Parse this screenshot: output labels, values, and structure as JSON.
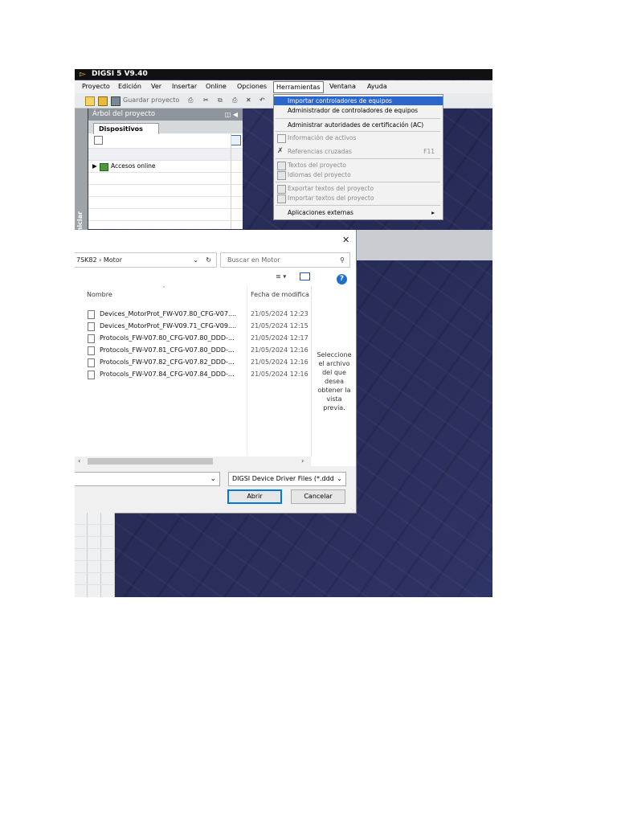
{
  "app": {
    "title": "DIGSI 5 V9.40"
  },
  "menubar": {
    "items": [
      "Proyecto",
      "Edición",
      "Ver",
      "Insertar",
      "Online",
      "Opciones",
      "Herramientas",
      "Ventana",
      "Ayuda"
    ]
  },
  "toolbar": {
    "save_label": "Guardar proyecto"
  },
  "project_tree": {
    "header": "Árbol del proyecto",
    "tab": "Dispositivos",
    "item": "Accesos online",
    "side_label": "Iniciar"
  },
  "tools_menu": {
    "items": [
      {
        "label": "Importar controladores de equipos",
        "shortcut": "",
        "state": "highlighted"
      },
      {
        "label": "Administrador de controladores de equipos",
        "shortcut": "",
        "state": "enabled"
      },
      {
        "label": "Administrar autoridades de certificación (AC)",
        "shortcut": "",
        "state": "enabled"
      },
      {
        "label": "Información de activos",
        "shortcut": "",
        "state": "disabled"
      },
      {
        "label": "Referencias cruzadas",
        "shortcut": "F11",
        "state": "disabled"
      },
      {
        "label": "Textos del proyecto",
        "shortcut": "",
        "state": "disabled"
      },
      {
        "label": "Idiomas del proyecto",
        "shortcut": "",
        "state": "disabled"
      },
      {
        "label": "Exportar textos del proyecto",
        "shortcut": "",
        "state": "disabled"
      },
      {
        "label": "Importar textos del proyecto",
        "shortcut": "",
        "state": "disabled"
      },
      {
        "label": "Aplicaciones externas",
        "shortcut": "",
        "state": "enabled"
      }
    ]
  },
  "file_dialog": {
    "close_glyph": "✕",
    "path": "7SK82  ›  Motor",
    "search_placeholder": "Buscar en Motor",
    "columns": {
      "name": "Nombre",
      "date": "Fecha de modifica"
    },
    "files": [
      {
        "name": "Devices_MotorProt_FW-V07.80_CFG-V07....",
        "date": "21/05/2024 12:23"
      },
      {
        "name": "Devices_MotorProt_FW-V09.71_CFG-V09....",
        "date": "21/05/2024 12:15"
      },
      {
        "name": "Protocols_FW-V07.80_CFG-V07.80_DDD-...",
        "date": "21/05/2024 12:17"
      },
      {
        "name": "Protocols_FW-V07.81_CFG-V07.80_DDD-...",
        "date": "21/05/2024 12:16"
      },
      {
        "name": "Protocols_FW-V07.82_CFG-V07.82_DDD-...",
        "date": "21/05/2024 12:16"
      },
      {
        "name": "Protocols_FW-V07.84_CFG-V07.84_DDD-...",
        "date": "21/05/2024 12:16"
      }
    ],
    "preview_text": "Seleccione el archivo del que desea obtener la vista previa.",
    "file_name_value": "",
    "file_type": "DIGSI Device Driver Files (*.ddd",
    "open_label": "Abrir",
    "cancel_label": "Cancelar"
  }
}
